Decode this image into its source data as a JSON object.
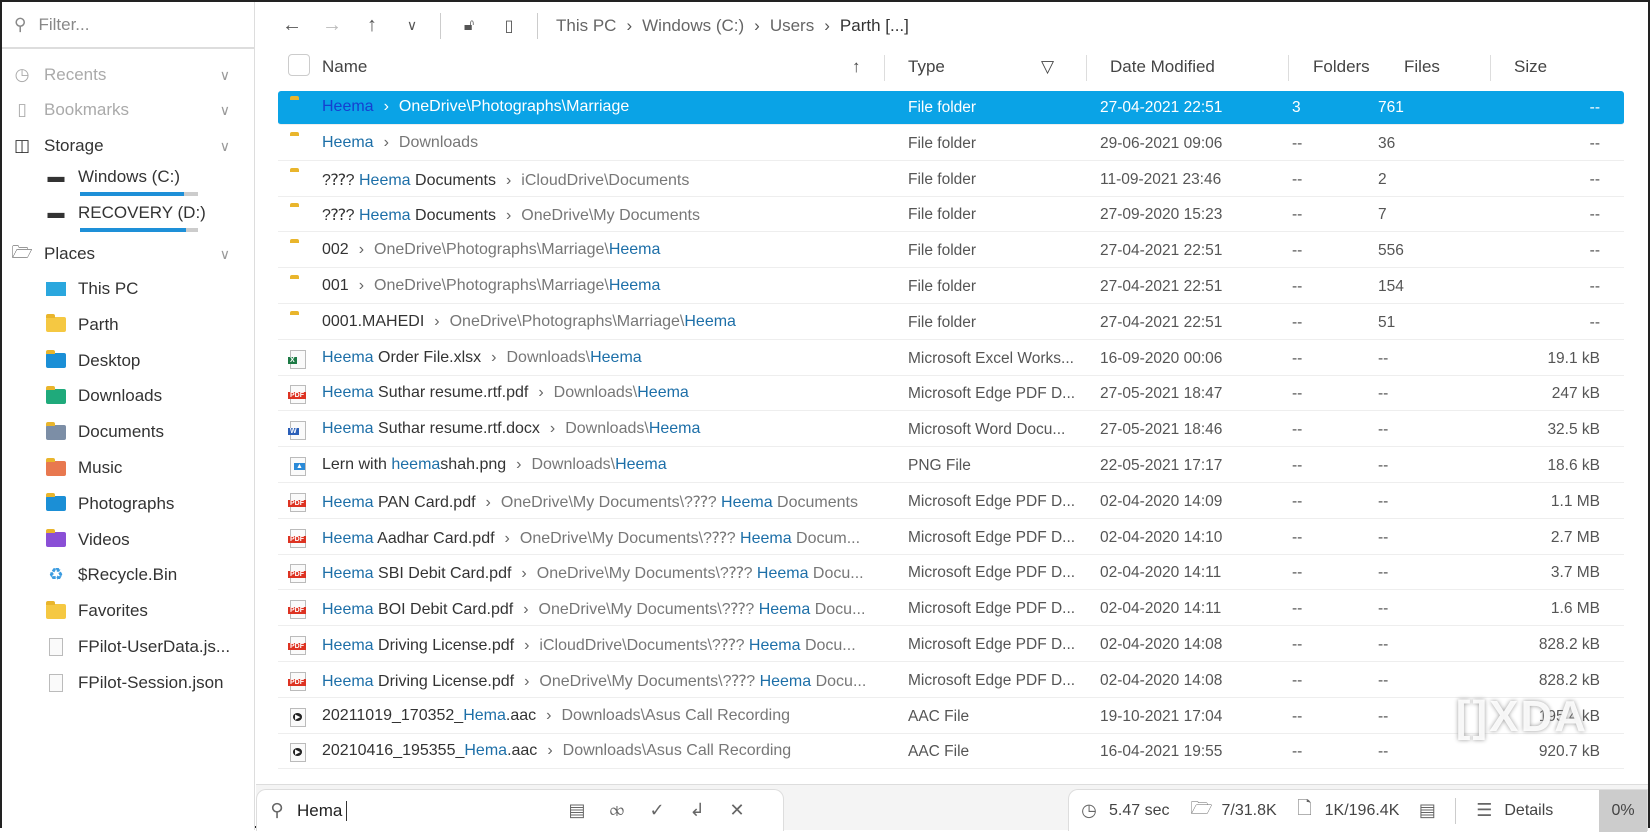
{
  "sidebar": {
    "filter_placeholder": "Filter...",
    "recents": "Recents",
    "bookmarks": "Bookmarks",
    "storage": "Storage",
    "drives": [
      {
        "label": "Windows (C:)",
        "used": 0.88
      },
      {
        "label": "RECOVERY (D:)",
        "used": 0.9
      }
    ],
    "places": "Places",
    "items": [
      "This PC",
      "Parth",
      "Desktop",
      "Downloads",
      "Documents",
      "Music",
      "Photographs",
      "Videos",
      "$Recycle.Bin",
      "Favorites",
      "FPilot-UserData.js...",
      "FPilot-Session.json"
    ]
  },
  "toolbar": {
    "breadcrumb": [
      "This PC",
      "Windows (C:)",
      "Users",
      "Parth [...]"
    ]
  },
  "columns": {
    "name": "Name",
    "type": "Type",
    "date": "Date Modified",
    "folders": "Folders",
    "files": "Files",
    "size": "Size"
  },
  "rows": [
    {
      "icon": "folder",
      "n": [
        "",
        "Heema",
        ""
      ],
      "p": [
        "OneDrive\\Photographs\\Marriage",
        "",
        ""
      ],
      "type": "File folder",
      "date": "27-04-2021 22:51",
      "folders": "3",
      "files": "761",
      "size": "--",
      "selected": true
    },
    {
      "icon": "folder",
      "n": [
        "",
        "Heema",
        ""
      ],
      "p": [
        "Downloads",
        "",
        ""
      ],
      "type": "File folder",
      "date": "29-06-2021 09:06",
      "folders": "--",
      "files": "36",
      "size": "--"
    },
    {
      "icon": "folder",
      "n": [
        "?⁇? ",
        "Heema",
        " Documents"
      ],
      "p": [
        "iCloudDrive\\Documents",
        "",
        ""
      ],
      "type": "File folder",
      "date": "11-09-2021 23:46",
      "folders": "--",
      "files": "2",
      "size": "--"
    },
    {
      "icon": "folder",
      "n": [
        "?⁇? ",
        "Heema",
        " Documents"
      ],
      "p": [
        "OneDrive\\My Documents",
        "",
        ""
      ],
      "type": "File folder",
      "date": "27-09-2020 15:23",
      "folders": "--",
      "files": "7",
      "size": "--"
    },
    {
      "icon": "folder",
      "n": [
        "002",
        "",
        ""
      ],
      "p": [
        "OneDrive\\Photographs\\Marriage\\",
        "Heema",
        ""
      ],
      "type": "File folder",
      "date": "27-04-2021 22:51",
      "folders": "--",
      "files": "556",
      "size": "--"
    },
    {
      "icon": "folder",
      "n": [
        "001",
        "",
        ""
      ],
      "p": [
        "OneDrive\\Photographs\\Marriage\\",
        "Heema",
        ""
      ],
      "type": "File folder",
      "date": "27-04-2021 22:51",
      "folders": "--",
      "files": "154",
      "size": "--"
    },
    {
      "icon": "folder",
      "n": [
        "0001.MAHEDI",
        "",
        ""
      ],
      "p": [
        "OneDrive\\Photographs\\Marriage\\",
        "Heema",
        ""
      ],
      "type": "File folder",
      "date": "27-04-2021 22:51",
      "folders": "--",
      "files": "51",
      "size": "--"
    },
    {
      "icon": "xlsx",
      "n": [
        "",
        "Heema",
        " Order File.xlsx"
      ],
      "p": [
        "Downloads\\",
        "Heema",
        ""
      ],
      "type": "Microsoft Excel Works...",
      "date": "16-09-2020 00:06",
      "folders": "--",
      "files": "--",
      "size": "19.1 kB"
    },
    {
      "icon": "pdf",
      "n": [
        "",
        "Heema",
        " Suthar resume.rtf.pdf"
      ],
      "p": [
        "Downloads\\",
        "Heema",
        ""
      ],
      "type": "Microsoft Edge PDF D...",
      "date": "27-05-2021 18:47",
      "folders": "--",
      "files": "--",
      "size": "247 kB"
    },
    {
      "icon": "docx",
      "n": [
        "",
        "Heema",
        " Suthar resume.rtf.docx"
      ],
      "p": [
        "Downloads\\",
        "Heema",
        ""
      ],
      "type": "Microsoft Word Docu...",
      "date": "27-05-2021 18:46",
      "folders": "--",
      "files": "--",
      "size": "32.5 kB"
    },
    {
      "icon": "png",
      "n": [
        "Lern with ",
        "heema",
        "shah.png"
      ],
      "p": [
        "Downloads\\",
        "Heema",
        ""
      ],
      "type": "PNG File",
      "date": "22-05-2021 17:17",
      "folders": "--",
      "files": "--",
      "size": "18.6 kB"
    },
    {
      "icon": "pdf",
      "n": [
        "",
        "Heema",
        " PAN Card.pdf"
      ],
      "p": [
        "OneDrive\\My Documents\\?⁇? ",
        "Heema",
        " Documents"
      ],
      "type": "Microsoft Edge PDF D...",
      "date": "02-04-2020 14:09",
      "folders": "--",
      "files": "--",
      "size": "1.1 MB"
    },
    {
      "icon": "pdf",
      "n": [
        "",
        "Heema",
        " Aadhar Card.pdf"
      ],
      "p": [
        "OneDrive\\My Documents\\?⁇? ",
        "Heema",
        " Docum..."
      ],
      "type": "Microsoft Edge PDF D...",
      "date": "02-04-2020 14:10",
      "folders": "--",
      "files": "--",
      "size": "2.7 MB"
    },
    {
      "icon": "pdf",
      "n": [
        "",
        "Heema",
        " SBI Debit Card.pdf"
      ],
      "p": [
        "OneDrive\\My Documents\\?⁇? ",
        "Heema",
        " Docu..."
      ],
      "type": "Microsoft Edge PDF D...",
      "date": "02-04-2020 14:11",
      "folders": "--",
      "files": "--",
      "size": "3.7 MB"
    },
    {
      "icon": "pdf",
      "n": [
        "",
        "Heema",
        " BOI Debit Card.pdf"
      ],
      "p": [
        "OneDrive\\My Documents\\?⁇? ",
        "Heema",
        " Docu..."
      ],
      "type": "Microsoft Edge PDF D...",
      "date": "02-04-2020 14:11",
      "folders": "--",
      "files": "--",
      "size": "1.6 MB"
    },
    {
      "icon": "pdf",
      "n": [
        "",
        "Heema",
        " Driving License.pdf"
      ],
      "p": [
        "iCloudDrive\\Documents\\?⁇? ",
        "Heema",
        " Docu..."
      ],
      "type": "Microsoft Edge PDF D...",
      "date": "02-04-2020 14:08",
      "folders": "--",
      "files": "--",
      "size": "828.2 kB"
    },
    {
      "icon": "pdf",
      "n": [
        "",
        "Heema",
        " Driving License.pdf"
      ],
      "p": [
        "OneDrive\\My Documents\\?⁇? ",
        "Heema",
        " Docu..."
      ],
      "type": "Microsoft Edge PDF D...",
      "date": "02-04-2020 14:08",
      "folders": "--",
      "files": "--",
      "size": "828.2 kB"
    },
    {
      "icon": "aac",
      "n": [
        "20211019_170352_",
        "Hema",
        ".aac"
      ],
      "p": [
        "Downloads\\Asus Call Recording",
        "",
        ""
      ],
      "type": "AAC File",
      "date": "19-10-2021 17:04",
      "folders": "--",
      "files": "--",
      "size": "195.4 kB"
    },
    {
      "icon": "aac",
      "n": [
        "20210416_195355_",
        "Hema",
        ".aac"
      ],
      "p": [
        "Downloads\\Asus Call Recording",
        "",
        ""
      ],
      "type": "AAC File",
      "date": "16-04-2021 19:55",
      "folders": "--",
      "files": "--",
      "size": "920.7 kB"
    }
  ],
  "bottom": {
    "search": "Hema",
    "time": "5.47 sec",
    "folders": "7/31.8K",
    "files": "1K/196.4K",
    "view": "Details",
    "progress": "0%"
  },
  "watermark": "XDA"
}
